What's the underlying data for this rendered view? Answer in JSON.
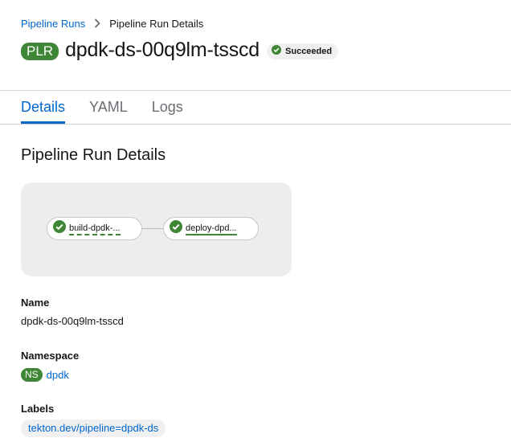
{
  "breadcrumb": {
    "parent_label": "Pipeline Runs",
    "current_label": "Pipeline Run Details"
  },
  "header": {
    "badge": "PLR",
    "title": "dpdk-ds-00q9lm-tsscd",
    "status": "Succeeded",
    "status_icon": "check-circle-icon"
  },
  "tabs": [
    {
      "label": "Details",
      "active": true
    },
    {
      "label": "YAML",
      "active": false
    },
    {
      "label": "Logs",
      "active": false
    }
  ],
  "section": {
    "title": "Pipeline Run Details"
  },
  "graph": {
    "tasks": [
      {
        "name": "build-dpdk-...",
        "status": "succeeded"
      },
      {
        "name": "deploy-dpd...",
        "status": "succeeded"
      }
    ]
  },
  "details": {
    "name_label": "Name",
    "name_value": "dpdk-ds-00q9lm-tsscd",
    "namespace_label": "Namespace",
    "namespace_badge": "NS",
    "namespace_value": "dpdk",
    "labels_label": "Labels",
    "labels": [
      "tekton.dev/pipeline=dpdk-ds"
    ]
  },
  "colors": {
    "accent": "#0066cc",
    "success": "#3e8635"
  }
}
